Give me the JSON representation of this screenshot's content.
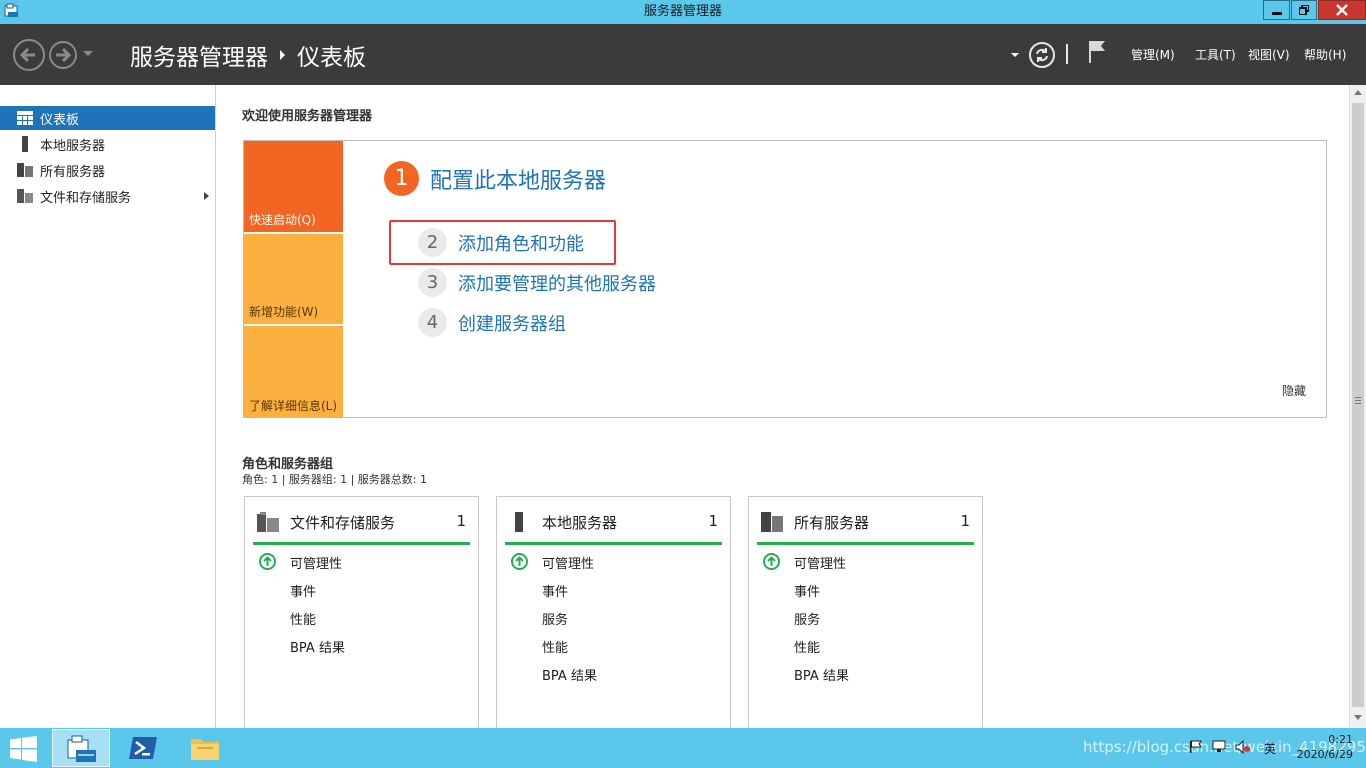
{
  "window": {
    "title": "服务器管理器"
  },
  "header": {
    "breadcrumb_root": "服务器管理器",
    "breadcrumb_current": "仪表板",
    "menus": {
      "manage": "管理(M)",
      "tools": "工具(T)",
      "view": "视图(V)",
      "help": "帮助(H)"
    }
  },
  "sidebar": {
    "items": [
      {
        "label": "仪表板",
        "icon": "dashboard-grid-icon",
        "active": true
      },
      {
        "label": "本地服务器",
        "icon": "server-icon"
      },
      {
        "label": "所有服务器",
        "icon": "servers-icon"
      },
      {
        "label": "文件和存储服务",
        "icon": "storage-icon",
        "has_children": true
      }
    ]
  },
  "welcome": {
    "title": "欢迎使用服务器管理器",
    "tiles": {
      "quick_start": "快速启动(Q)",
      "whats_new": "新增功能(W)",
      "learn_more": "了解详细信息(L)"
    },
    "steps": [
      {
        "num": "1",
        "text": "配置此本地服务器"
      },
      {
        "num": "2",
        "text": "添加角色和功能",
        "highlighted": true
      },
      {
        "num": "3",
        "text": "添加要管理的其他服务器"
      },
      {
        "num": "4",
        "text": "创建服务器组"
      }
    ],
    "hide": "隐藏"
  },
  "roles": {
    "title": "角色和服务器组",
    "summary": "角色: 1 | 服务器组: 1 | 服务器总数: 1",
    "cards": [
      {
        "title": "文件和存储服务",
        "count": "1",
        "rows": [
          "可管理性",
          "事件",
          "性能",
          "BPA 结果"
        ]
      },
      {
        "title": "本地服务器",
        "count": "1",
        "rows": [
          "可管理性",
          "事件",
          "服务",
          "性能",
          "BPA 结果"
        ]
      },
      {
        "title": "所有服务器",
        "count": "1",
        "rows": [
          "可管理性",
          "事件",
          "服务",
          "性能",
          "BPA 结果"
        ]
      }
    ]
  },
  "taskbar": {
    "lang": "英",
    "time": "0:21",
    "date": "2020/6/29",
    "watermark": "https://blog.csdn.net/weixin_41982957"
  },
  "colors": {
    "titlebar": "#5bc7ea",
    "header": "#3b3b3b",
    "accent_blue": "#1f74b9",
    "tile_orange": "#f26522",
    "tile_yellow": "#fbb040",
    "status_green": "#23b14d",
    "highlight_red": "#e53935"
  }
}
